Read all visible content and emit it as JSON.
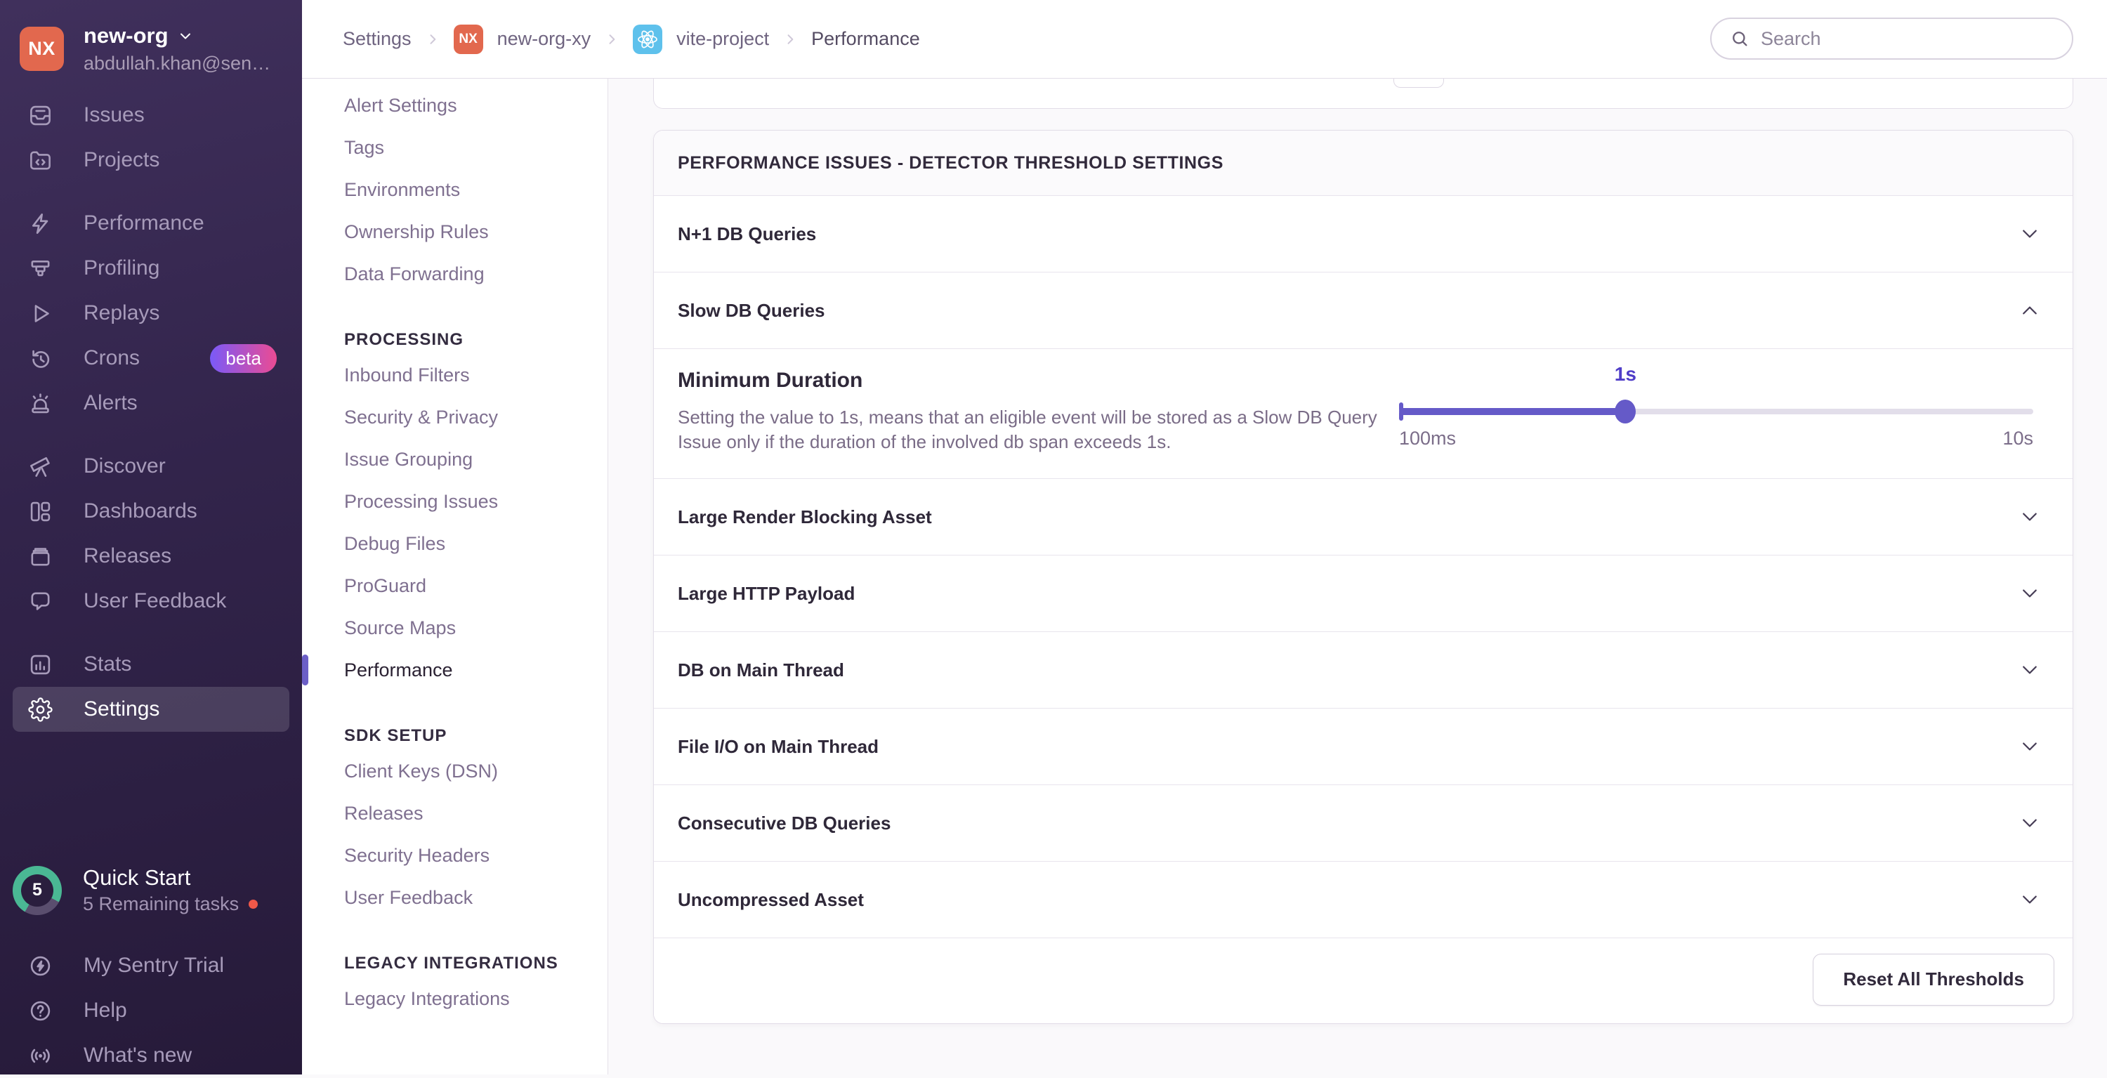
{
  "org": {
    "initials": "NX",
    "name": "new-org",
    "email": "abdullah.khan@sen…"
  },
  "sidebar": {
    "nav": [
      {
        "label": "Issues"
      },
      {
        "label": "Projects"
      },
      {
        "label": "Performance"
      },
      {
        "label": "Profiling"
      },
      {
        "label": "Replays"
      },
      {
        "label": "Crons",
        "badge": "beta"
      },
      {
        "label": "Alerts"
      },
      {
        "label": "Discover"
      },
      {
        "label": "Dashboards"
      },
      {
        "label": "Releases"
      },
      {
        "label": "User Feedback"
      },
      {
        "label": "Stats"
      },
      {
        "label": "Settings"
      }
    ],
    "quickstart": {
      "title": "Quick Start",
      "subtitle": "5 Remaining tasks",
      "count": "5"
    },
    "footer": [
      {
        "label": "My Sentry Trial"
      },
      {
        "label": "Help"
      },
      {
        "label": "What's new"
      }
    ]
  },
  "header": {
    "breadcrumb": {
      "item1": "Settings",
      "org_badge": "NX",
      "item2": "new-org-xy",
      "item3": "vite-project",
      "item4": "Performance"
    },
    "search_placeholder": "Search"
  },
  "subnav": {
    "group1": [
      "Alert Settings",
      "Tags",
      "Environments",
      "Ownership Rules",
      "Data Forwarding"
    ],
    "headings": {
      "processing": "PROCESSING",
      "sdk": "SDK SETUP",
      "legacy": "LEGACY INTEGRATIONS"
    },
    "group2": [
      "Inbound Filters",
      "Security & Privacy",
      "Issue Grouping",
      "Processing Issues",
      "Debug Files",
      "ProGuard",
      "Source Maps",
      "Performance"
    ],
    "active_item": "Performance",
    "group3": [
      "Client Keys (DSN)",
      "Releases",
      "Security Headers",
      "User Feedback"
    ],
    "group4": [
      "Legacy Integrations"
    ]
  },
  "main": {
    "panel_title": "PERFORMANCE ISSUES - DETECTOR THRESHOLD SETTINGS",
    "detectors_before": [
      "N+1 DB Queries",
      "Slow DB Queries"
    ],
    "expanded": {
      "detector": "Slow DB Queries",
      "title": "Minimum Duration",
      "description": "Setting the value to 1s, means that an eligible event will be stored as a Slow DB Query Issue only if the duration of the involved db span exceeds 1s.",
      "slider": {
        "value": "1s",
        "min": "100ms",
        "max": "10s",
        "percent": 35.7
      }
    },
    "detectors_after": [
      "Large Render Blocking Asset",
      "Large HTTP Payload",
      "DB on Main Thread",
      "File I/O on Main Thread",
      "Consecutive DB Queries",
      "Uncompressed Asset"
    ],
    "reset_label": "Reset All Thresholds"
  },
  "colors": {
    "accent": "#6C5FC7",
    "slider": "#655AC8",
    "sidebar_top": "#40305C",
    "sidebar_bottom": "#261A39",
    "avatar": "#E2684E",
    "react_badge": "#5EC1EC",
    "beta_gradient_from": "#7A5AF8",
    "beta_gradient_to": "#EB4B93",
    "progress_green": "#4AB894",
    "alert_red": "#F05849"
  }
}
